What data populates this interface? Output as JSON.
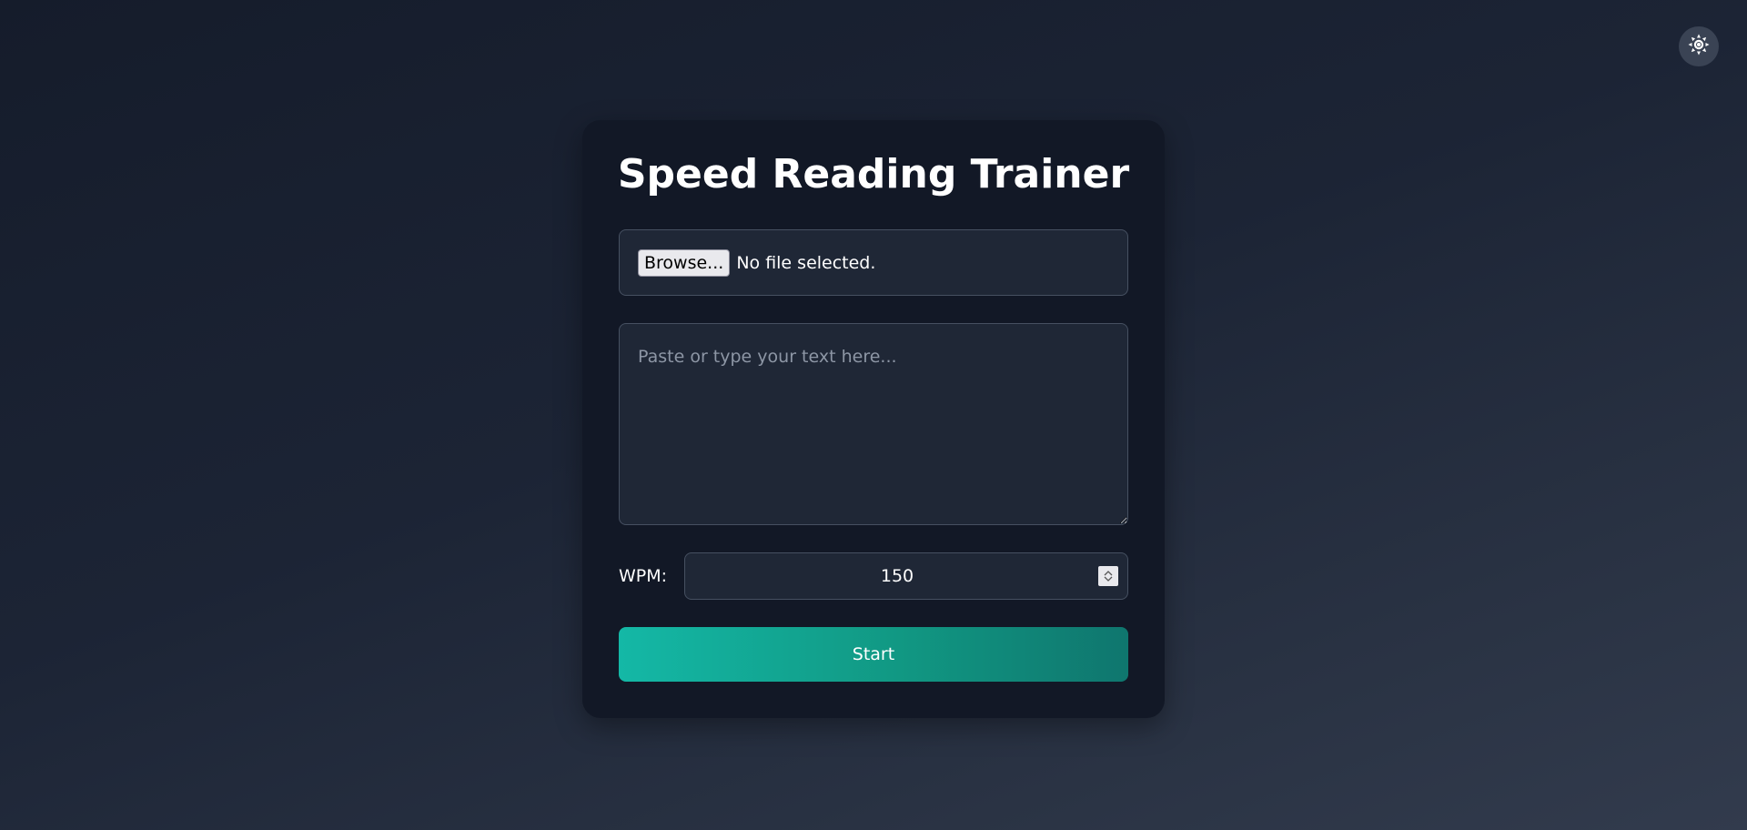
{
  "theme_toggle": {
    "icon": "sun-icon"
  },
  "app": {
    "title": "Speed Reading Trainer"
  },
  "file_input": {
    "button_label": "Browse...",
    "status": "No file selected."
  },
  "text_input": {
    "value": "",
    "placeholder": "Paste or type your text here..."
  },
  "wpm": {
    "label": "WPM:",
    "value": "150"
  },
  "start_button": {
    "label": "Start"
  },
  "colors": {
    "accent_start": "#14b8a6",
    "accent_end": "#0f766e",
    "card_bg": "#121826",
    "field_bg": "#1f2736"
  }
}
